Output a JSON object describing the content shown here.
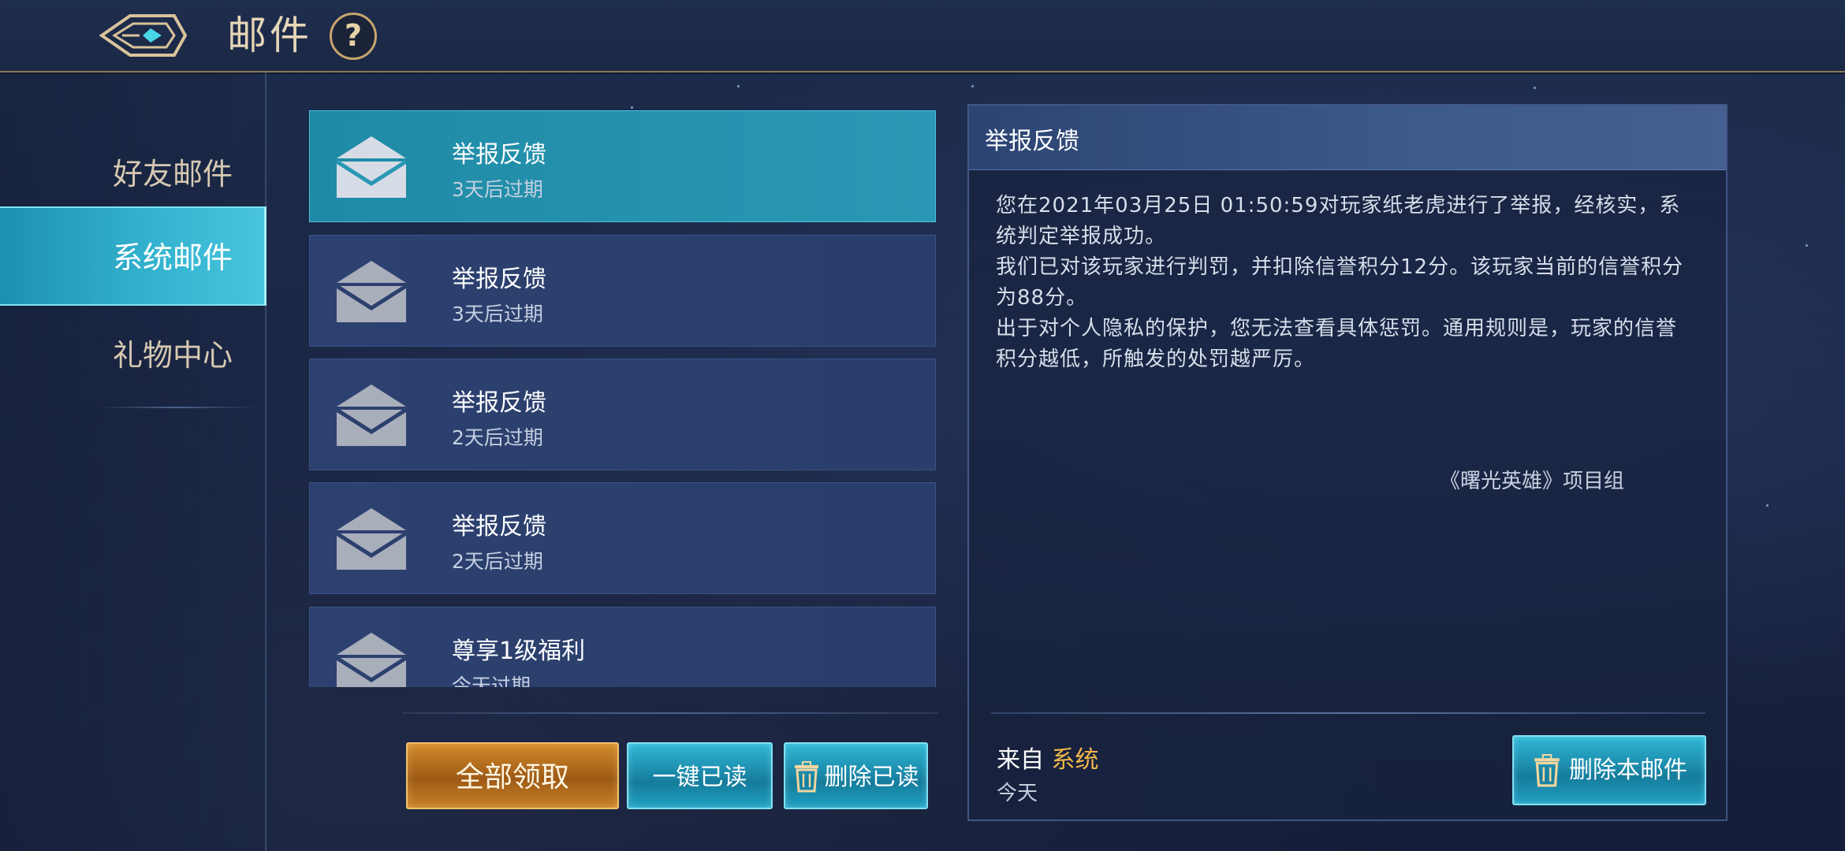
{
  "header": {
    "title": "邮件",
    "help_label": "?"
  },
  "sidebar": {
    "items": [
      {
        "label": "好友邮件"
      },
      {
        "label": "系统邮件",
        "active": true
      },
      {
        "label": "礼物中心"
      }
    ]
  },
  "mail_list": [
    {
      "title": "举报反馈",
      "expiry": "3天后过期",
      "selected": true
    },
    {
      "title": "举报反馈",
      "expiry": "3天后过期"
    },
    {
      "title": "举报反馈",
      "expiry": "2天后过期"
    },
    {
      "title": "举报反馈",
      "expiry": "2天后过期"
    },
    {
      "title": "尊享1级福利",
      "expiry": "今天过期"
    }
  ],
  "actions": {
    "claim_all": "全部领取",
    "read_all": "一键已读",
    "delete_read": "删除已读"
  },
  "detail": {
    "title": "举报反馈",
    "paragraphs": [
      "您在2021年03月25日 01:50:59对玩家纸老虎进行了举报，经核实，系统判定举报成功。",
      "我们已对该玩家进行判罚，并扣除信誉积分12分。该玩家当前的信誉积分为88分。",
      "出于对个人隐私的保护，您无法查看具体惩罚。通用规则是，玩家的信誉积分越低，所触发的处罚越严厉。"
    ],
    "signature": "《曙光英雄》项目组",
    "from_prefix": "来自",
    "sender": "系统",
    "date": "今天",
    "delete_label": "删除本邮件"
  },
  "colors": {
    "accent_cyan": "#2fb7d6",
    "gold": "#d28a2a",
    "sender_highlight": "#f2b84a"
  }
}
